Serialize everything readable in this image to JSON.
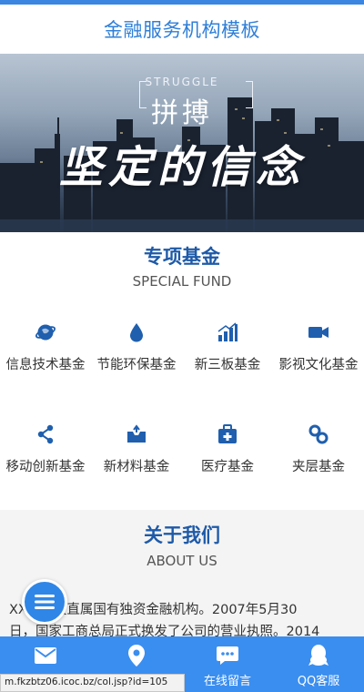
{
  "header": {
    "title": "金融服务机构模板"
  },
  "banner": {
    "sub_label": "STRUGGLE",
    "main_label": "拼搏",
    "slogan": "坚定的信念",
    "slide_count": 2,
    "active_slide": 1
  },
  "special_fund": {
    "title": "专项基金",
    "subtitle": "SPECIAL FUND",
    "items": [
      {
        "label": "信息技术基金",
        "icon": "globe-icon"
      },
      {
        "label": "节能环保基金",
        "icon": "water-drop-icon"
      },
      {
        "label": "新三板基金",
        "icon": "bar-chart-icon"
      },
      {
        "label": "影视文化基金",
        "icon": "video-camera-icon"
      },
      {
        "label": "移动创新基金",
        "icon": "share-icon"
      },
      {
        "label": "新材料基金",
        "icon": "inbox-icon"
      },
      {
        "label": "医疗基金",
        "icon": "medical-kit-icon"
      },
      {
        "label": "夹层基金",
        "icon": "link-icon"
      }
    ]
  },
  "about": {
    "title": "关于我们",
    "subtitle": "ABOUT US",
    "line1": "XX是中央直属国有独资金融机构。2007年5月30",
    "line2": "日，国家工商总局正式换发了公司的营业执照。2014"
  },
  "bottom_nav": {
    "items": [
      {
        "label": "",
        "icon": "envelope-icon"
      },
      {
        "label": "",
        "icon": "map-pin-icon"
      },
      {
        "label": "在线留言",
        "icon": "chat-icon"
      },
      {
        "label": "QQ客服",
        "icon": "qq-penguin-icon"
      }
    ]
  },
  "status_url": "m.fkzbtz06.icoc.bz/col.jsp?id=105",
  "colors": {
    "accent": "#3a8ef0",
    "title_blue": "#1e5aa8",
    "header_blue": "#2f7fd8"
  }
}
